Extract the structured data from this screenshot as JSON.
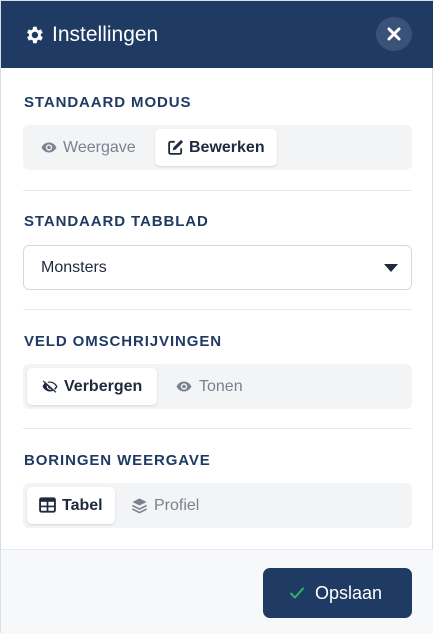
{
  "header": {
    "title": "Instellingen",
    "icon": "gear-icon",
    "close_icon": "close-icon"
  },
  "sections": {
    "mode": {
      "title": "STANDAARD MODUS",
      "options": [
        {
          "label": "Weergave",
          "icon": "eye-icon",
          "active": false
        },
        {
          "label": "Bewerken",
          "icon": "edit-icon",
          "active": true
        }
      ]
    },
    "tab": {
      "title": "STANDAARD TABBLAD",
      "selected": "Monsters"
    },
    "descriptions": {
      "title": "VELD OMSCHRIJVINGEN",
      "options": [
        {
          "label": "Verbergen",
          "icon": "eye-slash-icon",
          "active": true
        },
        {
          "label": "Tonen",
          "icon": "eye-icon",
          "active": false
        }
      ]
    },
    "boreholes": {
      "title": "BORINGEN WEERGAVE",
      "options": [
        {
          "label": "Tabel",
          "icon": "table-icon",
          "active": true
        },
        {
          "label": "Profiel",
          "icon": "layers-icon",
          "active": false
        }
      ]
    }
  },
  "footer": {
    "save_label": "Opslaan",
    "save_icon": "check-icon"
  },
  "colors": {
    "primary": "#1f3a63",
    "success": "#2fb36a",
    "segment_bg": "#f3f4f6"
  }
}
